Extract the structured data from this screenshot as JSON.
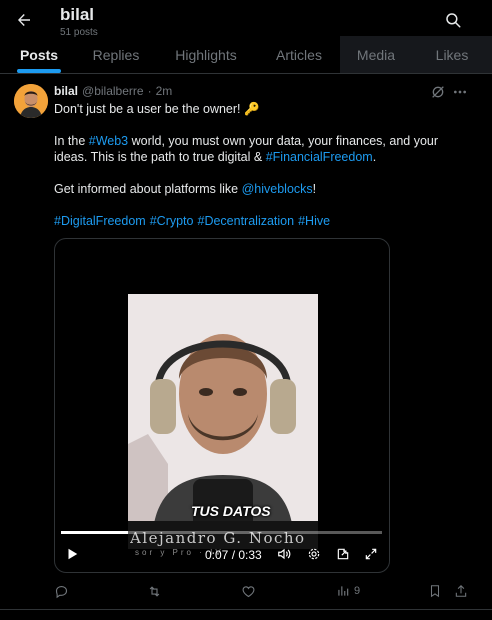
{
  "header": {
    "back_icon": "arrow-left-icon",
    "title": "bilal",
    "subtitle": "51 posts",
    "search_icon": "search-icon"
  },
  "tabs": [
    {
      "label": "Posts",
      "active": true
    },
    {
      "label": "Replies",
      "active": false
    },
    {
      "label": "Highlights",
      "active": false
    },
    {
      "label": "Articles",
      "active": false
    },
    {
      "label": "Media",
      "active": false
    },
    {
      "label": "Likes",
      "active": false
    }
  ],
  "post": {
    "author_name": "bilal",
    "author_handle": "@bilalberre",
    "separator": "·",
    "timestamp": "2m",
    "line1": "Don't just be a user be the owner! 🔑",
    "p2_part1": "In the ",
    "p2_link1": "#Web3",
    "p2_part2": " world, you must own your data, your finances, and your",
    "p2_part3": "ideas. This is the path to true digital & ",
    "p2_link2": "#FinancialFreedom",
    "p2_part4": ".",
    "p3_part1": "Get informed about platforms like ",
    "p3_link": "@hiveblocks",
    "p3_part2": "!",
    "hashtags": [
      "#DigitalFreedom",
      "#Crypto",
      "#Decentralization",
      "#Hive"
    ]
  },
  "video": {
    "caption": "TUS DATOS",
    "name_overlay": "Alejandro G. Nocho",
    "role_overlay": "sor y Pro    ·    IV",
    "time_readout": "0:07 / 0:33",
    "progress": 0.21
  },
  "actions": {
    "reply_icon": "reply-icon",
    "repost_icon": "repost-icon",
    "like_icon": "heart-icon",
    "views_icon": "bar-chart-icon",
    "views_count": "9",
    "bookmark_icon": "bookmark-icon",
    "share_icon": "share-icon"
  },
  "colors": {
    "background": "#000000",
    "accent": "#1d9bf0",
    "text": "#e7e9ea",
    "muted": "#71767b",
    "border": "#2f3336"
  }
}
